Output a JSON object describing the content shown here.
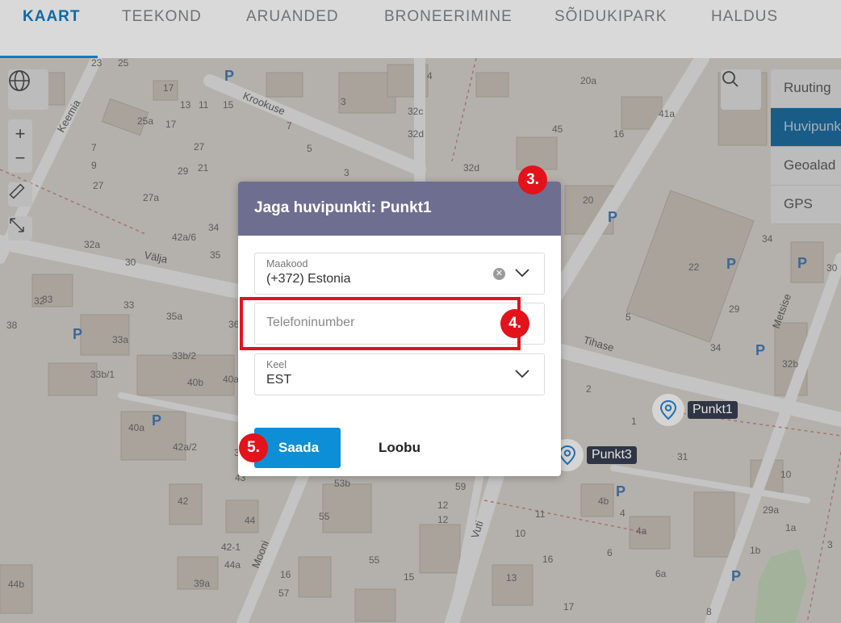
{
  "nav": {
    "tabs": [
      {
        "label": "KAART",
        "active": true
      },
      {
        "label": "TEEKOND",
        "active": false
      },
      {
        "label": "ARUANDED",
        "active": false
      },
      {
        "label": "BRONEERIMINE",
        "active": false
      },
      {
        "label": "SÕIDUKIPARK",
        "active": false
      },
      {
        "label": "HALDUS",
        "active": false
      }
    ]
  },
  "map": {
    "controls": {
      "zoom_in": "+",
      "zoom_out": "−"
    },
    "layers": [
      {
        "label": "Ruuting",
        "active": false
      },
      {
        "label": "Huvipunkt",
        "active": true
      },
      {
        "label": "Geoalad",
        "active": false
      },
      {
        "label": "GPS",
        "active": false
      }
    ],
    "streets": [
      "Keemia",
      "Krookuse",
      "Välja",
      "Tihase",
      "Metsise",
      "Mooni",
      "Vuti"
    ],
    "house_numbers": [
      "25",
      "23",
      "17",
      "13",
      "11",
      "15",
      "17",
      "25a",
      "7",
      "9",
      "27",
      "27a",
      "27",
      "29",
      "21",
      "7",
      "5",
      "3",
      "3",
      "4",
      "32c",
      "32d",
      "32d",
      "45",
      "20a",
      "41a",
      "16",
      "20",
      "22",
      "34",
      "32a",
      "30",
      "32",
      "33",
      "33",
      "34",
      "35",
      "35a",
      "36",
      "38",
      "33a",
      "33b/1",
      "33b/2",
      "40b",
      "40a",
      "40a",
      "42a/2",
      "42a/6",
      "29",
      "34",
      "32b",
      "30",
      "5",
      "2",
      "1",
      "31",
      "31",
      "43",
      "42",
      "44",
      "42-1",
      "44a",
      "44b",
      "39a",
      "43",
      "53b",
      "55",
      "55",
      "16",
      "57",
      "59",
      "12",
      "12",
      "10",
      "11",
      "16",
      "15",
      "13",
      "17",
      "4b",
      "4",
      "4a",
      "6",
      "6a",
      "8",
      "10",
      "29a",
      "1a",
      "1b",
      "3",
      "11"
    ],
    "pois": [
      {
        "label": "Punkt1"
      },
      {
        "label": "Punkt3"
      }
    ]
  },
  "dialog": {
    "title": "Jaga huvipunkti: Punkt1",
    "country_field": {
      "label": "Maakood",
      "value": "(+372) Estonia"
    },
    "phone_field": {
      "placeholder": "Telefoninumber"
    },
    "language_field": {
      "label": "Keel",
      "value": "EST"
    },
    "send_label": "Saada",
    "cancel_label": "Loobu"
  },
  "annotations": {
    "step3": "3.",
    "step4": "4.",
    "step5": "5."
  },
  "colors": {
    "accent": "#0b6aa8",
    "dialog_header": "#6e6e91",
    "primary_button": "#0c8fd6",
    "annotation": "#e3121b"
  }
}
